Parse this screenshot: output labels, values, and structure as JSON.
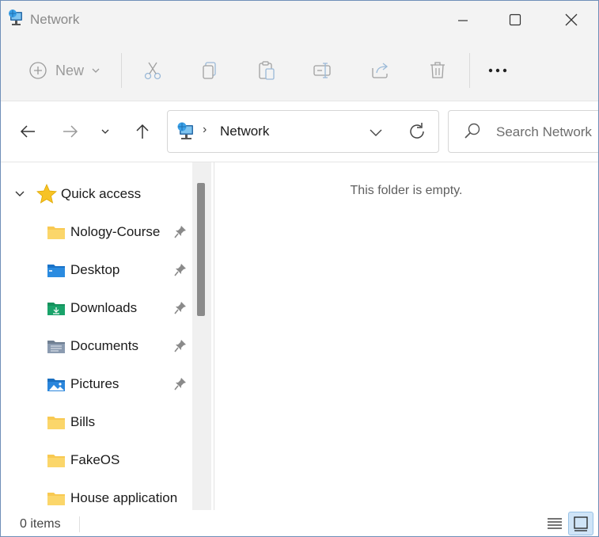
{
  "window": {
    "title": "Network",
    "controls": [
      "minimize",
      "maximize",
      "close"
    ]
  },
  "command_bar": {
    "new_label": "New",
    "buttons": [
      "cut-icon",
      "copy-icon",
      "paste-icon",
      "rename-icon",
      "share-icon",
      "delete-icon",
      "more-icon"
    ]
  },
  "address_bar": {
    "location_icon": "network-icon",
    "path": "Network",
    "search_placeholder": "Search Network"
  },
  "nav_pane": {
    "quick_access_label": "Quick access",
    "items": [
      {
        "label": "Nology-Course",
        "icon": "folder-icon",
        "pinned": true
      },
      {
        "label": "Desktop",
        "icon": "desktop-folder-icon",
        "pinned": true
      },
      {
        "label": "Downloads",
        "icon": "downloads-folder-icon",
        "pinned": true
      },
      {
        "label": "Documents",
        "icon": "documents-folder-icon",
        "pinned": true
      },
      {
        "label": "Pictures",
        "icon": "pictures-folder-icon",
        "pinned": true
      },
      {
        "label": "Bills",
        "icon": "folder-icon",
        "pinned": false
      },
      {
        "label": "FakeOS",
        "icon": "folder-icon",
        "pinned": false
      },
      {
        "label": "House application",
        "icon": "folder-icon",
        "pinned": false
      }
    ]
  },
  "content": {
    "empty_message": "This folder is empty."
  },
  "status_bar": {
    "item_count": "0 items"
  },
  "colors": {
    "folder_yellow": "#f8c952",
    "accent_blue": "#1a73c9",
    "download_green": "#1aa36a",
    "star_gold": "#f7c325"
  }
}
